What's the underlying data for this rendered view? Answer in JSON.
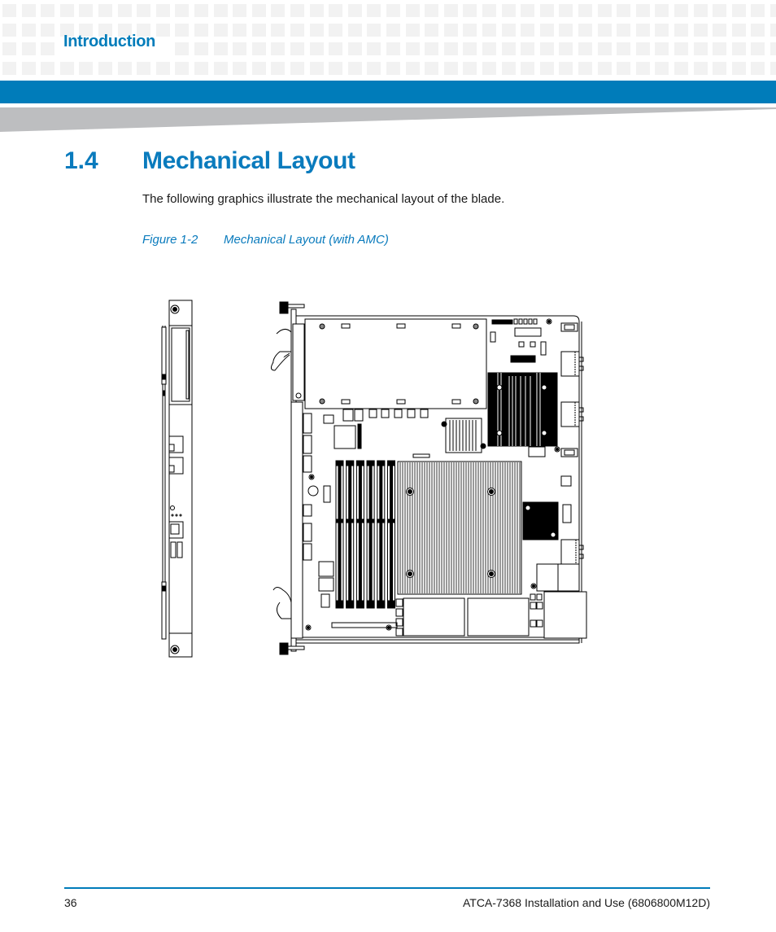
{
  "header": {
    "section": "Introduction",
    "accent_color": "#007cba"
  },
  "main": {
    "section_number": "1.4",
    "section_title": "Mechanical Layout",
    "intro_text": "The following graphics illustrate the mechanical layout of the blade.",
    "figure": {
      "number": "Figure 1-2",
      "caption": "Mechanical Layout (with AMC)",
      "views": [
        "front-panel-view",
        "board-top-view"
      ]
    }
  },
  "footer": {
    "page_number": "36",
    "document_title": "ATCA-7368 Installation and Use (6806800M12D)"
  }
}
